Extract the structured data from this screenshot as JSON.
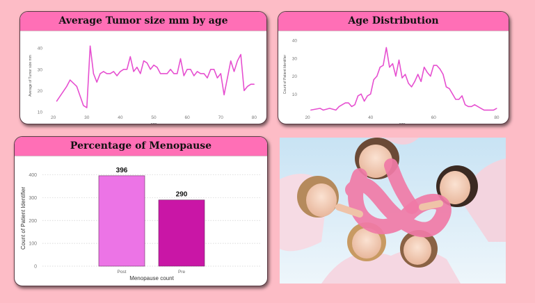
{
  "colors": {
    "background": "#fdbcc6",
    "title_bar": "#ff6fb6",
    "line": "#e64fd0",
    "bar_post": "#ec74e6",
    "bar_pre": "#c916a6"
  },
  "photo": {
    "icon": "breast-cancer-awareness-ribbon-photo"
  },
  "chart_data": [
    {
      "type": "line",
      "title": "Average Tumor size mm by age",
      "xlabel": "age",
      "ylabel": "Average of Tumor size mm",
      "xlim": [
        18,
        82
      ],
      "ylim": [
        10,
        44
      ],
      "xticks": [
        20,
        30,
        40,
        50,
        60,
        70,
        80
      ],
      "yticks": [
        10,
        20,
        30,
        40
      ],
      "grid": false,
      "x": [
        21,
        24,
        25,
        27,
        29,
        30,
        31,
        32,
        33,
        34,
        35,
        36,
        37,
        38,
        39,
        40,
        41,
        42,
        43,
        44,
        45,
        46,
        47,
        48,
        49,
        50,
        51,
        52,
        53,
        54,
        55,
        56,
        57,
        58,
        59,
        60,
        61,
        62,
        63,
        64,
        65,
        66,
        67,
        68,
        69,
        70,
        71,
        72,
        73,
        74,
        75,
        76,
        77,
        78,
        79,
        80
      ],
      "y": [
        15,
        22,
        25,
        22,
        13,
        12,
        41,
        28,
        24,
        28,
        29,
        28,
        28,
        29,
        27,
        29,
        30,
        30,
        36,
        29,
        31,
        28,
        34,
        33,
        30,
        32,
        31,
        28,
        28,
        28,
        30,
        28,
        28,
        35,
        27,
        30,
        30,
        27,
        29,
        28,
        28,
        26,
        30,
        30,
        26,
        28,
        18,
        26,
        34,
        29,
        34,
        37,
        20,
        22,
        23,
        23
      ]
    },
    {
      "type": "line",
      "title": "Age Distribution",
      "xlabel": "age",
      "ylabel": "Count of Patient Identifier",
      "xlim": [
        18,
        82
      ],
      "ylim": [
        0,
        42
      ],
      "xticks": [
        20,
        40,
        60,
        80
      ],
      "yticks": [
        10,
        20,
        30,
        40
      ],
      "grid": false,
      "x": [
        21,
        24,
        25,
        27,
        29,
        30,
        31,
        32,
        33,
        34,
        35,
        36,
        37,
        38,
        39,
        40,
        41,
        42,
        43,
        44,
        45,
        46,
        47,
        48,
        49,
        50,
        51,
        52,
        53,
        54,
        55,
        56,
        57,
        58,
        59,
        60,
        61,
        62,
        63,
        64,
        65,
        66,
        67,
        68,
        69,
        70,
        71,
        72,
        73,
        74,
        75,
        76,
        77,
        78,
        79,
        80
      ],
      "y": [
        1,
        2,
        1,
        2,
        1,
        3,
        4,
        5,
        5,
        3,
        4,
        9,
        10,
        6,
        9,
        10,
        18,
        20,
        25,
        26,
        36,
        25,
        27,
        20,
        29,
        19,
        21,
        16,
        14,
        17,
        21,
        17,
        25,
        22,
        20,
        26,
        26,
        24,
        21,
        14,
        13,
        10,
        7,
        7,
        9,
        4,
        3,
        3,
        4,
        3,
        2,
        1,
        1,
        1,
        1,
        2
      ]
    },
    {
      "type": "bar",
      "title": "Percentage of Menopause",
      "xlabel": "Menopause count",
      "ylabel": "Count of Patient Identifier",
      "categories": [
        "Post",
        "Pre"
      ],
      "values": [
        396,
        290
      ],
      "value_labels": [
        "396",
        "290"
      ],
      "ylim": [
        0,
        420
      ],
      "yticks": [
        0,
        100,
        200,
        300,
        400
      ],
      "grid": true
    }
  ]
}
